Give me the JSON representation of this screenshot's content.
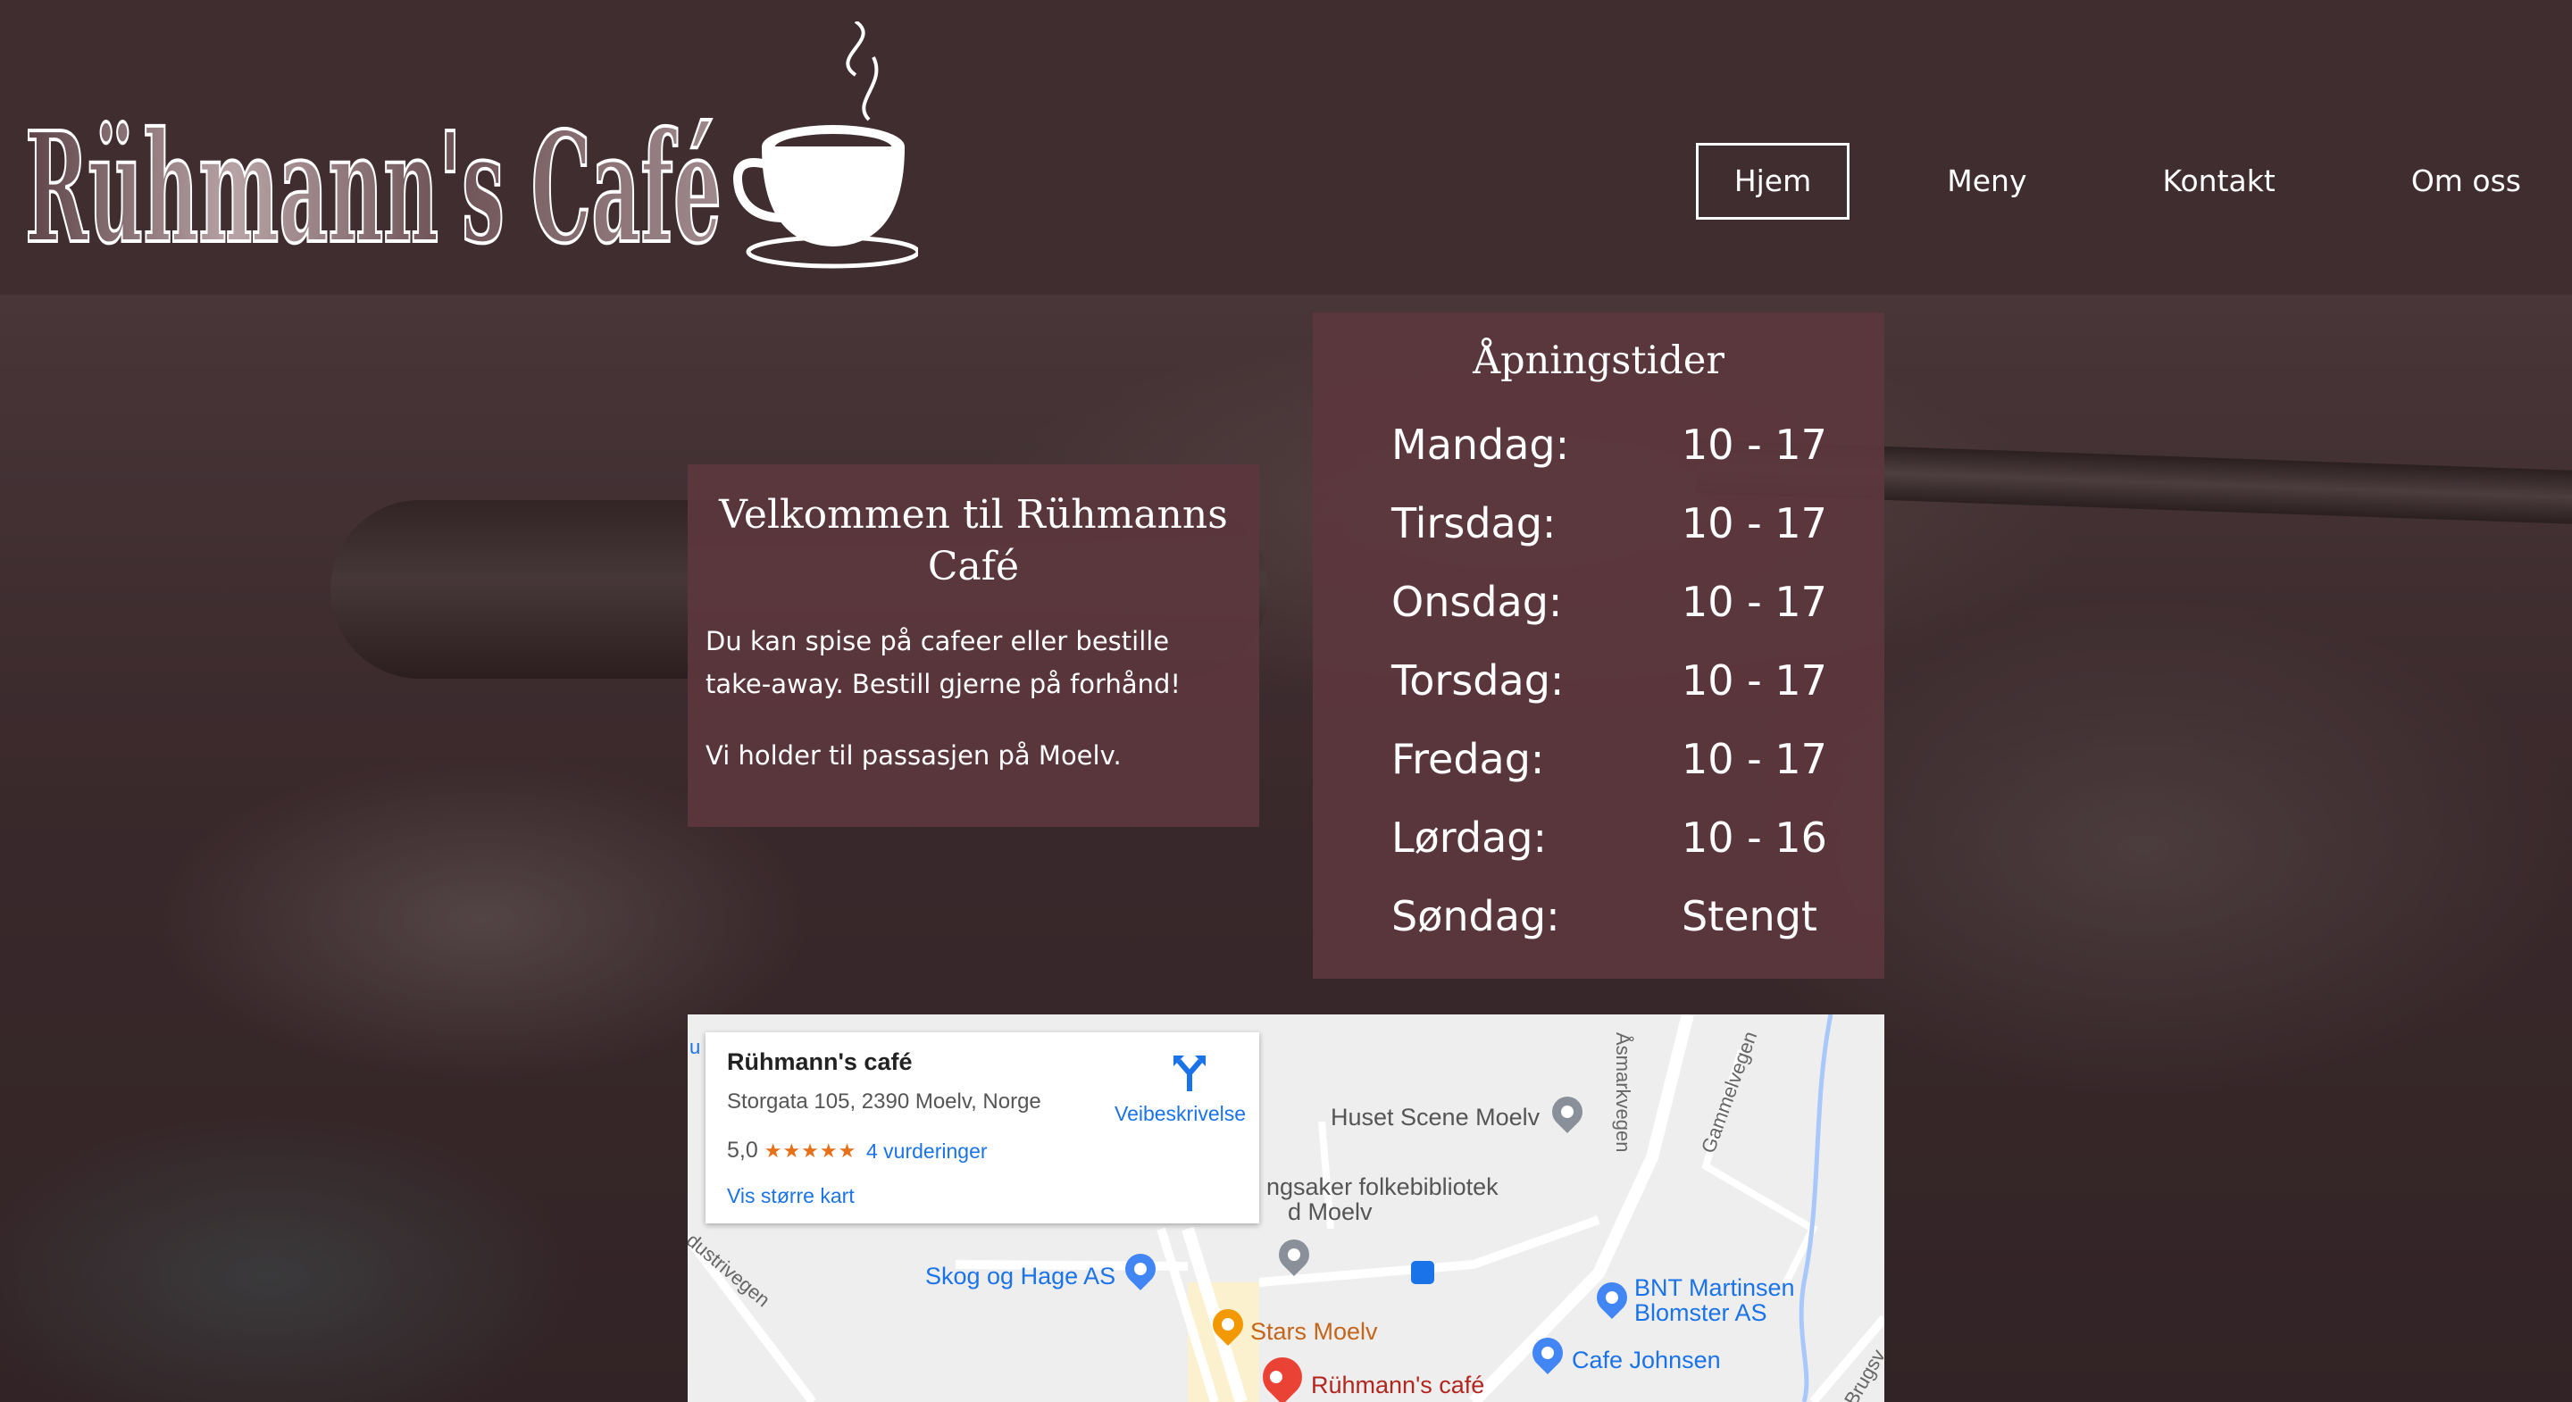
{
  "header": {
    "logo_text": "Rühmann's Café",
    "nav": [
      {
        "label": "Hjem",
        "active": true
      },
      {
        "label": "Meny",
        "active": false
      },
      {
        "label": "Kontakt",
        "active": false
      },
      {
        "label": "Om oss",
        "active": false
      }
    ]
  },
  "welcome": {
    "title": "Velkommen til Rühmanns Café",
    "paragraph1": "Du kan spise på cafeer eller bestille take-away. Bestill gjerne på forhånd!",
    "paragraph2": "Vi holder til passasjen på Moelv."
  },
  "hours": {
    "title": "Åpningstider",
    "rows": [
      {
        "day": "Mandag:",
        "time": "10 - 17"
      },
      {
        "day": "Tirsdag:",
        "time": "10 - 17"
      },
      {
        "day": "Onsdag:",
        "time": "10 - 17"
      },
      {
        "day": "Torsdag:",
        "time": "10 - 17"
      },
      {
        "day": "Fredag:",
        "time": "10 - 17"
      },
      {
        "day": "Lørdag:",
        "time": "10 - 16"
      },
      {
        "day": "Søndag:",
        "time": "Stengt"
      }
    ]
  },
  "map": {
    "card": {
      "name": "Rühmann's café",
      "address": "Storgata 105, 2390 Moelv, Norge",
      "rating": "5,0",
      "stars": "★★★★★",
      "reviews": "4 vurderinger",
      "bigger_map": "Vis større kart",
      "directions": "Veibeskrivelse"
    },
    "pois": {
      "huset": "Huset Scene Moelv",
      "bibliotek_1": "ngsaker folkebibliotek",
      "bibliotek_2": "d Moelv",
      "skog": "Skog og Hage AS",
      "stars": "Stars Moelv",
      "bnt_1": "BNT Martinsen",
      "bnt_2": "Blomster AS",
      "johnsen": "Cafe Johnsen",
      "ruhmann": "Rühmann's café"
    },
    "roads": {
      "asmark": "Åsmarkvegen",
      "gammel": "Gammelvegen",
      "industri": "dustrivegen",
      "brugs": "Brugsv",
      "edge": "u"
    }
  },
  "colors": {
    "header_bg": "#3f2d30",
    "panel_bg": "#5c373e",
    "link_blue": "#1a73e8",
    "pin_red": "#ea4335"
  }
}
